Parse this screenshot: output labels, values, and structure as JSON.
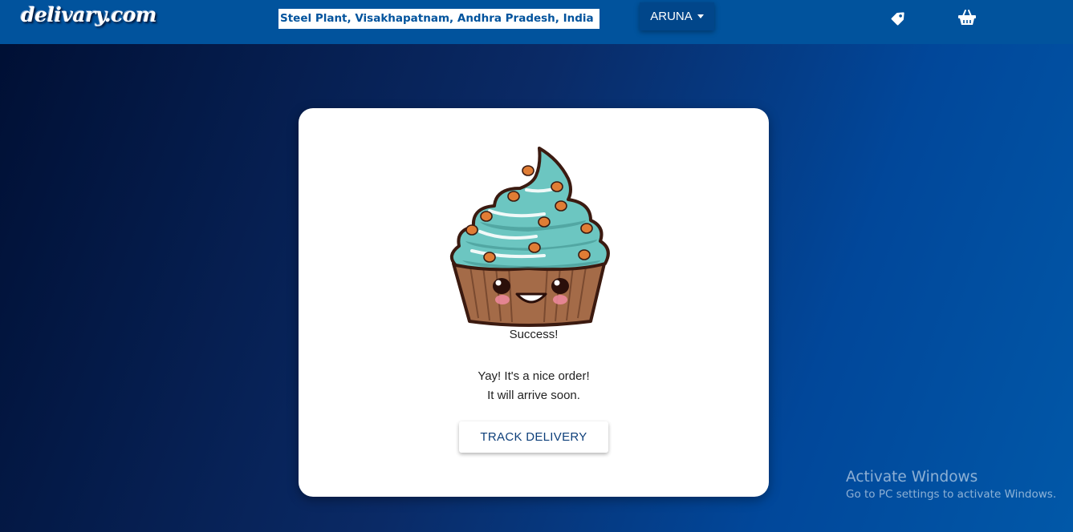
{
  "header": {
    "logo": "delivary.com",
    "location": "Steel Plant, Visakhapatnam, Andhra Pradesh, India",
    "user_name": "ARUNA",
    "icons": [
      "tag-icon",
      "basket-icon"
    ]
  },
  "card": {
    "image": "cupcake",
    "title": "Success!",
    "message_line1": "Yay! It's a nice order!",
    "message_line2": "It will arrive soon.",
    "button_label": "TRACK DELIVERY"
  },
  "watermark": {
    "title": "Activate Windows",
    "subtitle": "Go to PC settings to activate Windows."
  },
  "colors": {
    "navbar": "#01539d",
    "button_text": "#0d3f7a",
    "frosting": "#6cc6c1",
    "cup": "#a46b48"
  }
}
